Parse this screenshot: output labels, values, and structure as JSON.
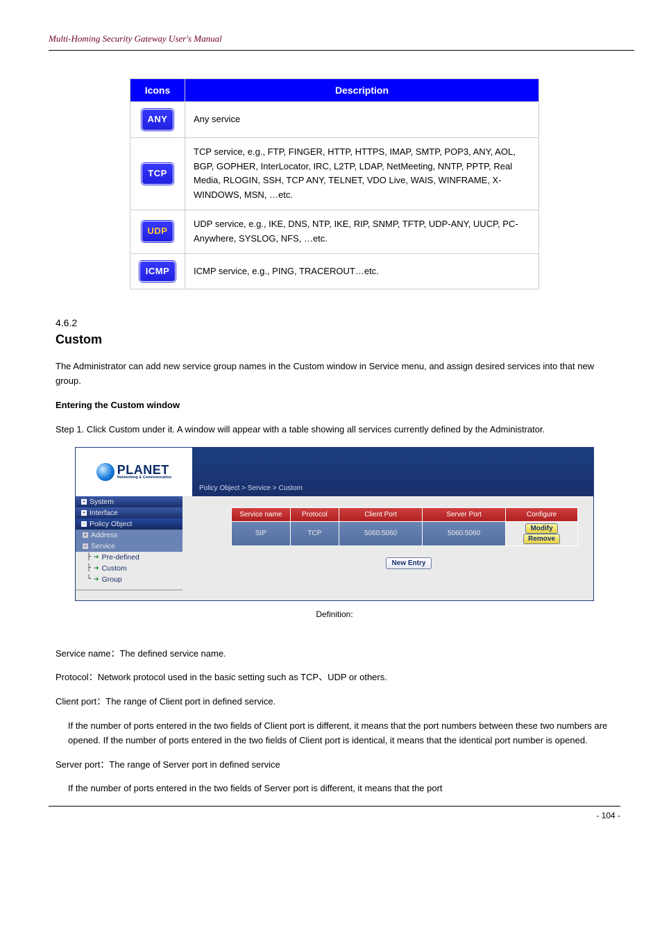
{
  "header": {
    "left": "Multi-Homing Security Gateway User's Manual",
    "right": ""
  },
  "proto_table": {
    "head": [
      "Icons",
      "Description"
    ],
    "rows": [
      {
        "badge": "ANY",
        "badgeClass": "",
        "desc": "Any service"
      },
      {
        "badge": "TCP",
        "badgeClass": "",
        "desc": "TCP service, e.g., FTP, FINGER, HTTP, HTTPS, IMAP, SMTP, POP3, ANY, AOL, BGP, GOPHER, InterLocator, IRC, L2TP, LDAP, NetMeeting, NNTP, PPTP, Real Media, RLOGIN, SSH, TCP ANY, TELNET, VDO Live, WAIS, WINFRAME, X-WINDOWS, MSN, …etc."
      },
      {
        "badge": "UDP",
        "badgeClass": "udp",
        "desc": "UDP service, e.g., IKE, DNS, NTP, IKE, RIP, SNMP, TFTP, UDP-ANY, UUCP, PC-Anywhere, SYSLOG, NFS, …etc."
      },
      {
        "badge": "ICMP",
        "badgeClass": "",
        "desc": "ICMP service, e.g., PING, TRACEROUT…etc."
      }
    ]
  },
  "section": {
    "num": "4.6.2",
    "title": "Custom",
    "p1": "The Administrator can add new service group names in the Custom window in Service menu, and assign desired services into that new group.",
    "p2": "Entering the Custom window",
    "p3": "Step 1. Click Custom under it. A window will appear with a table showing all services currently defined by the Administrator."
  },
  "shot": {
    "logo": {
      "name": "PLANET",
      "sub": "Networking & Communication"
    },
    "breadcrumb": "Policy Object > Service > Custom",
    "nav": {
      "system": "System",
      "interface": "Interface",
      "policy_object": "Policy Object",
      "address": "Address",
      "service": "Service",
      "predefined": "Pre-defined",
      "custom": "Custom",
      "group": "Group"
    },
    "grid": {
      "headers": [
        "Service name",
        "Protocol",
        "Client Port",
        "Server Port",
        "Configure"
      ],
      "row": {
        "service_name": "SIP",
        "protocol": "TCP",
        "client_port": "5060:5060",
        "server_port": "5060:5060",
        "modify": "Modify",
        "remove": "Remove"
      },
      "new_entry": "New Entry"
    }
  },
  "caption_text": "Definition:",
  "defs": {
    "service_name": "Service name：The defined service name.",
    "protocol": "Protocol：Network protocol used in the basic setting such as TCP、UDP or others.",
    "client_port": "Client port：The range of Client port in defined service.",
    "client_port_note": "If the number of ports entered in the two fields of Client port is different, it means that the port numbers between these two numbers are opened. If the number of ports entered in the two fields of Client port is identical, it means that the identical port number is opened.",
    "server_port": "Server port：The range of Server port in defined service",
    "server_port_note": "If the number of ports entered in the two fields of Server port is different, it means that the port"
  },
  "footer": {
    "left": "",
    "right": "- 104 -"
  }
}
